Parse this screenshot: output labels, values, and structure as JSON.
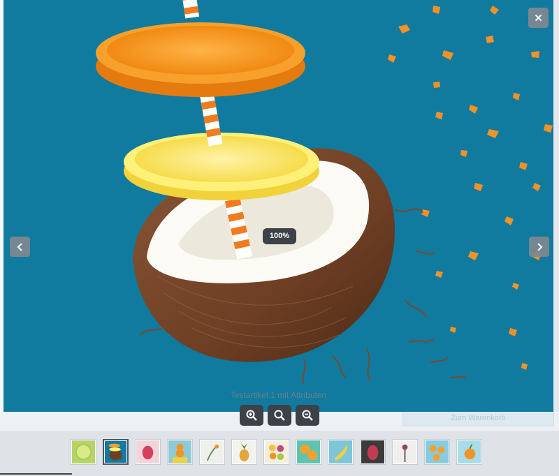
{
  "viewer": {
    "zoom_level": "100%",
    "caption": "Testartikel 1 mit Attributen",
    "close_symbol": "✕",
    "background_color": "#107a9f"
  },
  "page_behind": {
    "cart_button_label": "Zum Warenkorb"
  },
  "navigation": {
    "prev_icon": "chevron-left-icon",
    "next_icon": "chevron-right-icon"
  },
  "toolbar": {
    "buttons": [
      {
        "icon": "zoom-in-icon"
      },
      {
        "icon": "zoom-reset-icon"
      },
      {
        "icon": "zoom-out-icon"
      }
    ]
  },
  "thumbnails": [
    {
      "subject": "lime-slice",
      "bg": "#b7d36a",
      "active": false
    },
    {
      "subject": "coconut-citrus",
      "bg": "#107a9f",
      "active": true
    },
    {
      "subject": "raspberry",
      "bg": "#f0d6dc",
      "active": false
    },
    {
      "subject": "orange-stack",
      "bg": "#8fc9d8",
      "active": false
    },
    {
      "subject": "branch",
      "bg": "#eef0ee",
      "active": false
    },
    {
      "subject": "pineapple",
      "bg": "#f2f2ee",
      "active": false
    },
    {
      "subject": "fruit-slices",
      "bg": "#f3eede",
      "active": false
    },
    {
      "subject": "orange-halves",
      "bg": "#5fc3b0",
      "active": false
    },
    {
      "subject": "banana",
      "bg": "#7dc6d8",
      "active": false
    },
    {
      "subject": "dragon-fruit",
      "bg": "#3d3a3c",
      "active": false
    },
    {
      "subject": "herb",
      "bg": "#f1eeee",
      "active": false
    },
    {
      "subject": "orange-slices",
      "bg": "#86cbe0",
      "active": false
    },
    {
      "subject": "orange-single",
      "bg": "#a9dbe8",
      "active": false
    }
  ]
}
